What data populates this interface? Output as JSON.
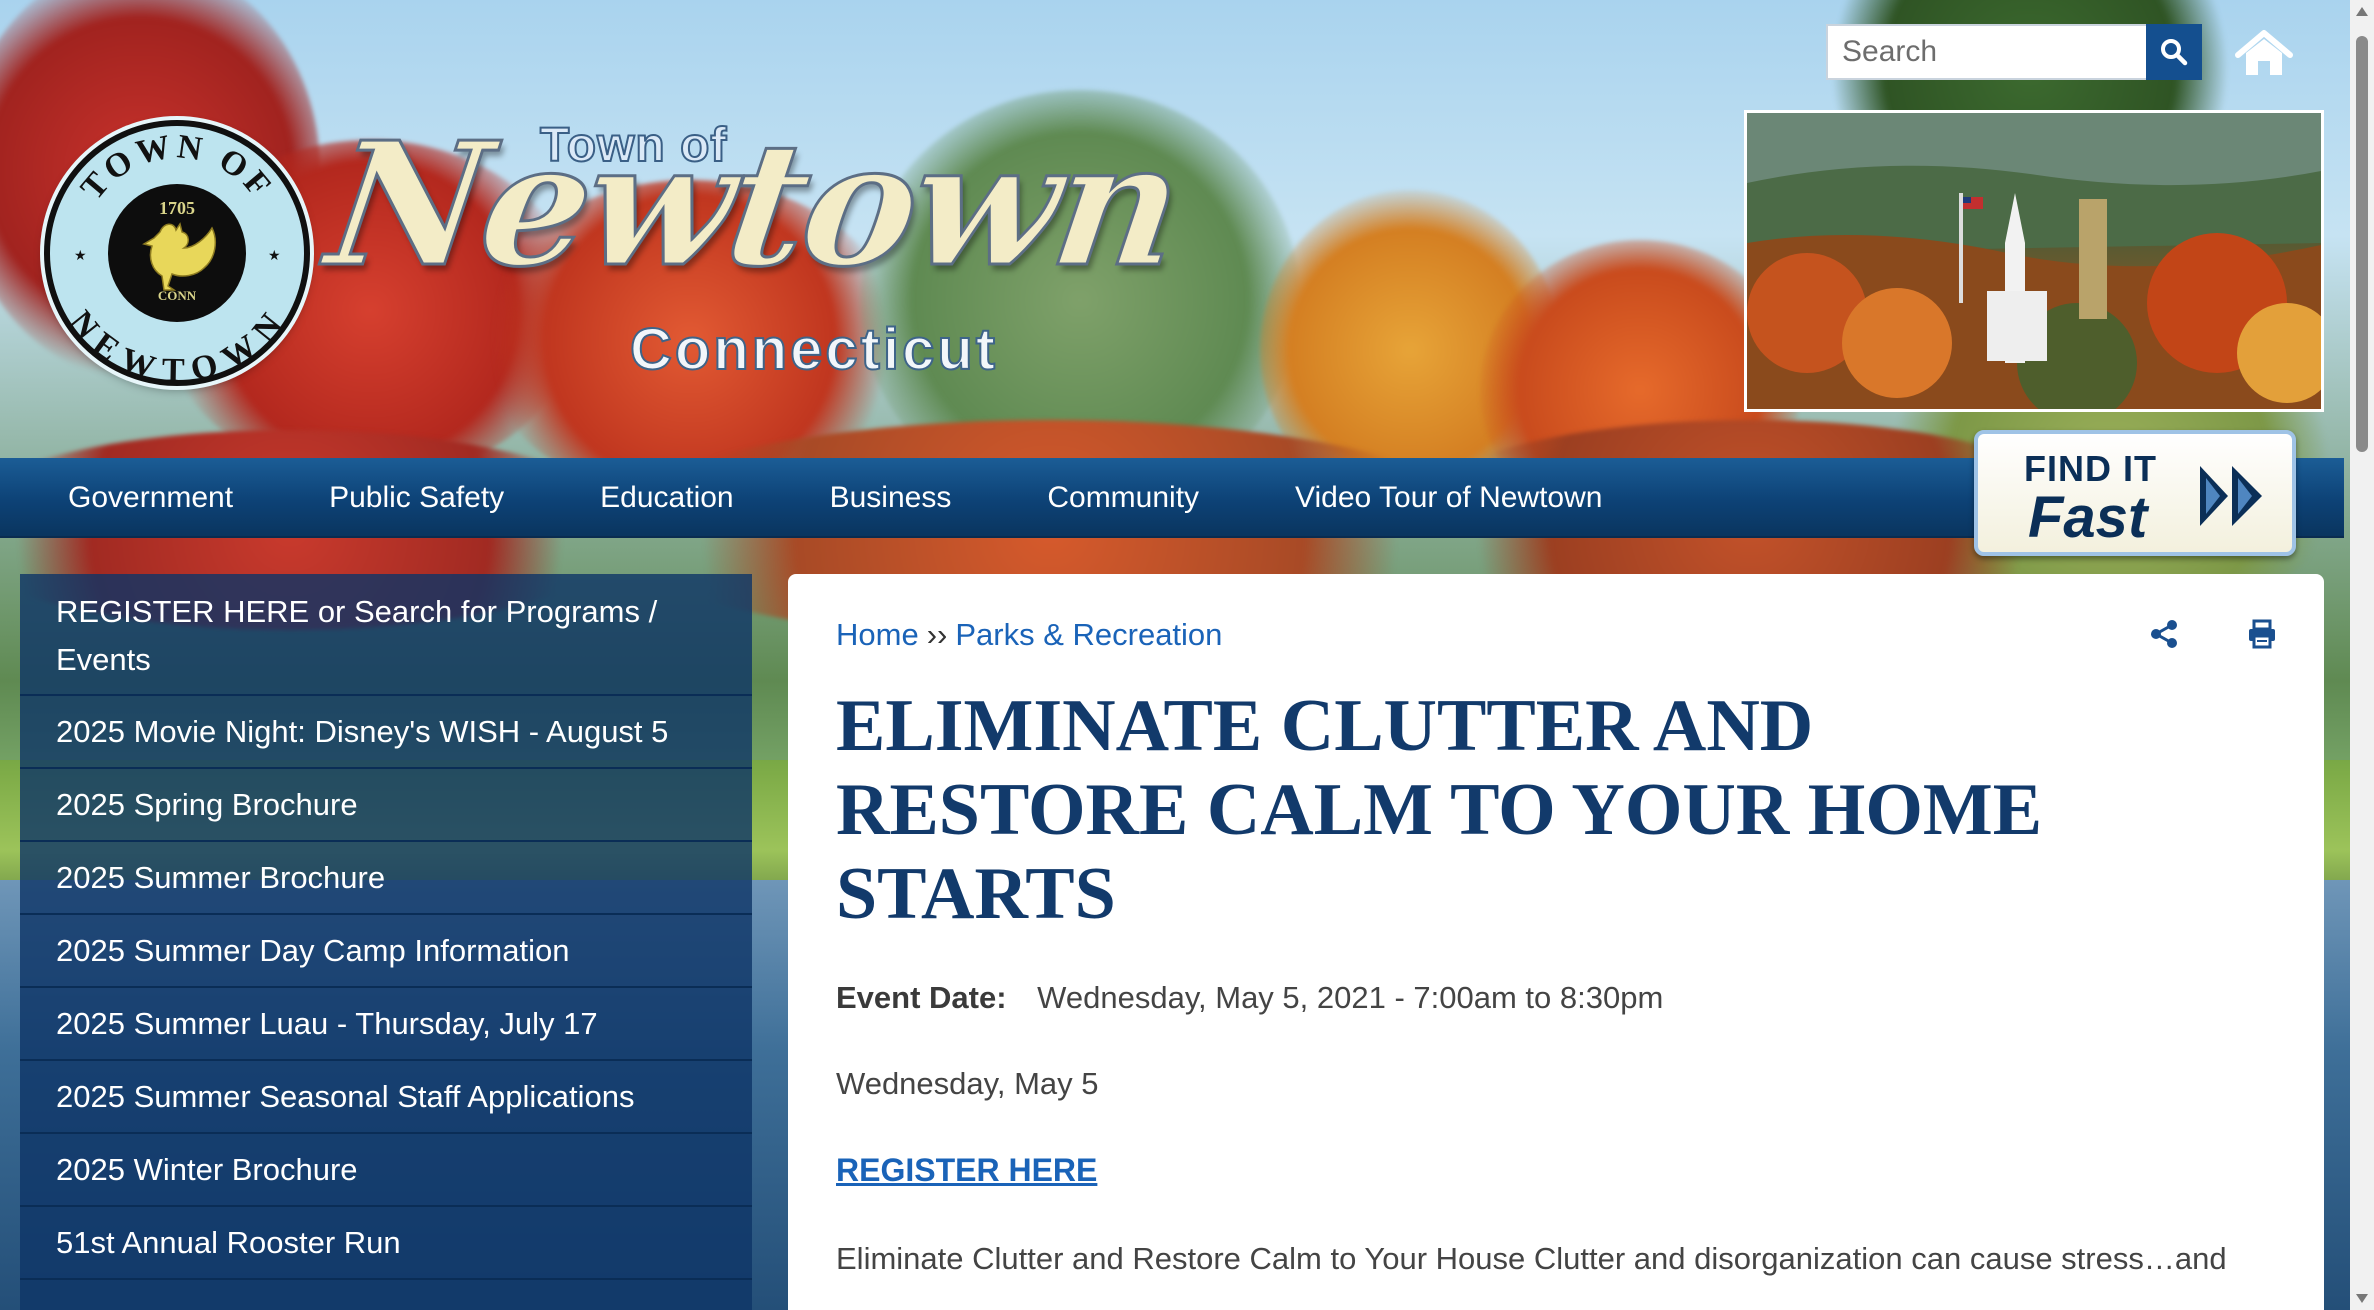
{
  "header": {
    "title_town_of": "Town of",
    "title_newtown": "Newtown",
    "title_state": "Connecticut",
    "seal": {
      "ring_top": "TOWN OF",
      "ring_bottom": "NEWTOWN",
      "year": "1705",
      "conn": "CONN"
    },
    "search": {
      "placeholder": "Search"
    },
    "find_it": {
      "top": "FIND IT",
      "bottom": "Fast"
    }
  },
  "nav": {
    "items": [
      {
        "label": "Government"
      },
      {
        "label": "Public Safety"
      },
      {
        "label": "Education"
      },
      {
        "label": "Business"
      },
      {
        "label": "Community"
      },
      {
        "label": "Video Tour of Newtown"
      }
    ]
  },
  "sidebar": {
    "items": [
      {
        "label": "REGISTER HERE or Search for Programs / Events"
      },
      {
        "label": "2025 Movie Night: Disney's WISH - August 5"
      },
      {
        "label": "2025 Spring Brochure"
      },
      {
        "label": "2025 Summer Brochure"
      },
      {
        "label": "2025 Summer Day Camp Information"
      },
      {
        "label": "2025 Summer Luau - Thursday, July 17"
      },
      {
        "label": "2025 Summer Seasonal Staff Applications"
      },
      {
        "label": "2025 Winter Brochure"
      },
      {
        "label": "51st Annual Rooster Run"
      }
    ]
  },
  "content": {
    "breadcrumb": {
      "home": "Home",
      "separator": "››",
      "parent": "Parks & Recreation"
    },
    "title": "ELIMINATE CLUTTER AND RESTORE CALM TO YOUR HOME STARTS",
    "event_date_label": "Event Date:",
    "event_date_value": "Wednesday, May 5, 2021 - 7:00am to 8:30pm",
    "event_day": "Wednesday, May 5",
    "register_link": "REGISTER HERE",
    "body_text": "Eliminate Clutter and Restore Calm to Your House Clutter and disorganization can cause stress…and"
  },
  "colors": {
    "nav_bg": "#0d4276",
    "title_color": "#123a6b",
    "link_color": "#1a63b8",
    "sidebar_bg": "#0e3466"
  },
  "icons": {
    "search": "search-icon",
    "home": "home-icon",
    "share": "share-icon",
    "print": "print-icon",
    "find_it_arrows": "double-chevron-right-icon"
  }
}
